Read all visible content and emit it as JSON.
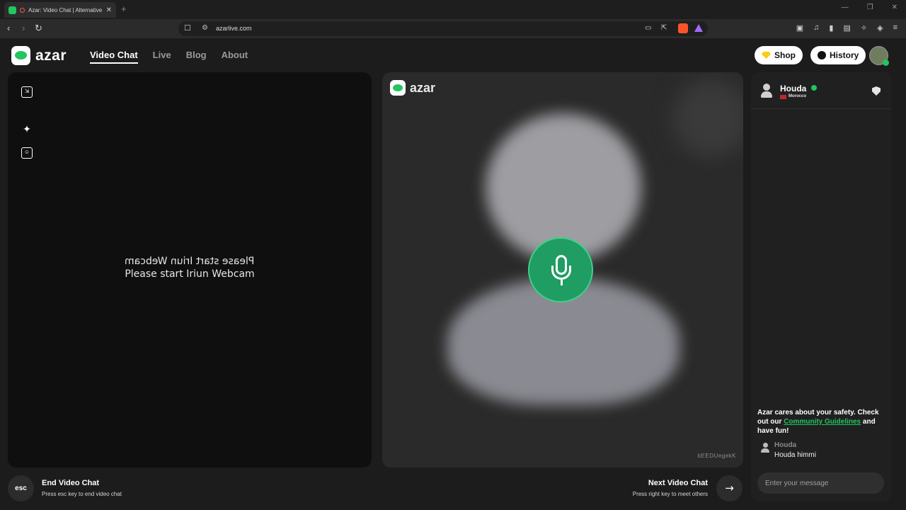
{
  "browser": {
    "tab_title": "Azar: Video Chat | Alternative",
    "tab_close": "✕",
    "new_tab": "+",
    "url": "azarlive.com"
  },
  "header": {
    "logo_text": "azar",
    "nav": [
      {
        "label": "Video Chat",
        "active": true
      },
      {
        "label": "Live",
        "active": false
      },
      {
        "label": "Blog",
        "active": false
      },
      {
        "label": "About",
        "active": false
      }
    ],
    "shop_label": "Shop",
    "history_label": "History"
  },
  "left_panel": {
    "message_mirrored": "Please start Iriun Webcam",
    "message": "Please start Iriun Webcam"
  },
  "remote": {
    "logo_text": "azar",
    "code": "bEEDUegekK"
  },
  "chat": {
    "partner_name": "Houda",
    "partner_country": "Morocco",
    "safety_text_1": "Azar cares about your safety. Check out our ",
    "safety_link": "Community Guidelines",
    "safety_text_2": " and have fun!",
    "messages": [
      {
        "sender": "Houda",
        "text": "Houda himmi"
      }
    ],
    "input_placeholder": "Enter your message"
  },
  "bottom": {
    "esc_label": "esc",
    "end_title": "End Video Chat",
    "end_sub": "Press esc key to end video chat",
    "next_title": "Next Video Chat",
    "next_sub": "Press right key to meet others",
    "next_arrow": "→"
  },
  "colors": {
    "accent": "#22c55e",
    "mic": "#1f9d62",
    "background": "#1c1c1c"
  }
}
